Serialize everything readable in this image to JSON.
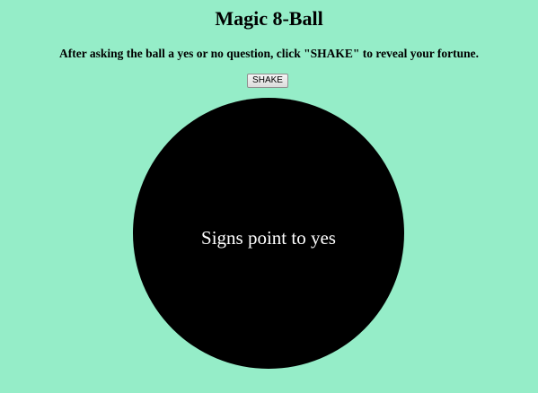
{
  "page": {
    "title": "Magic 8-Ball",
    "instructions": "After asking the ball a yes or no question, click \"SHAKE\" to reveal your fortune.",
    "background_color": "#95edc8"
  },
  "controls": {
    "shake_label": "SHAKE"
  },
  "ball": {
    "color": "#000000",
    "fortune": "Signs point to yes",
    "fortune_color": "#ffffff"
  }
}
